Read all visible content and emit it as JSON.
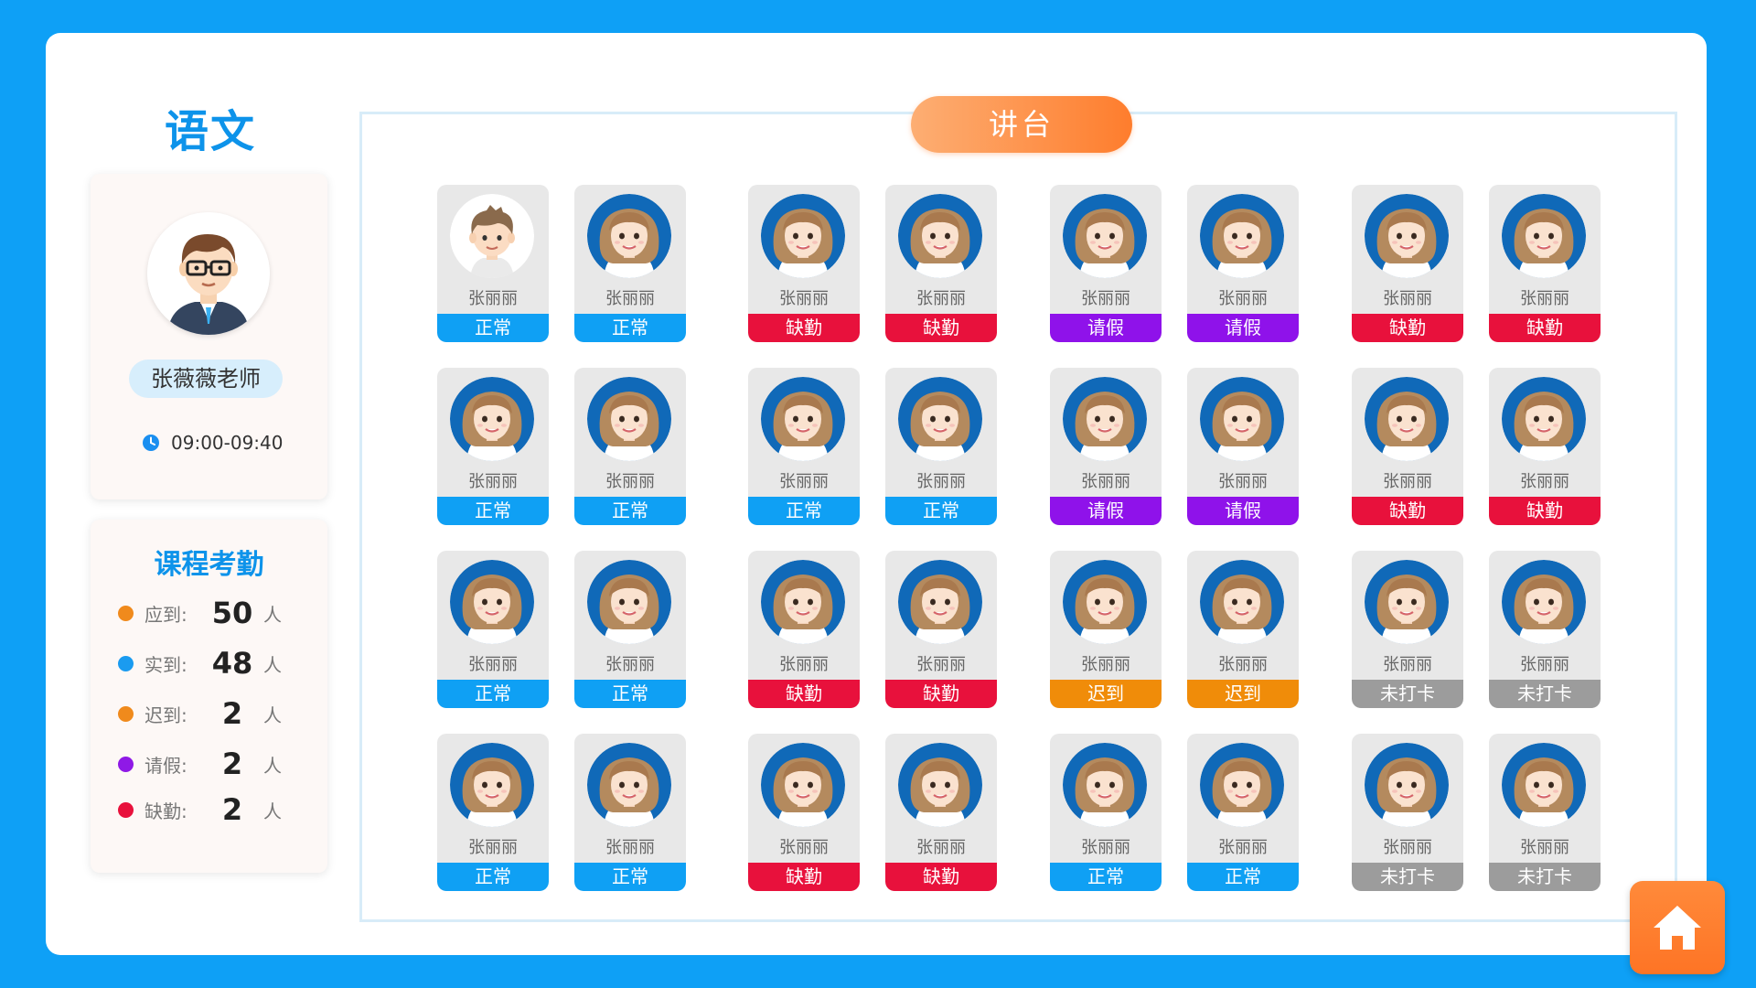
{
  "subject": {
    "title": "语文"
  },
  "teacher": {
    "name": "张薇薇老师",
    "time": "09:00-09:40"
  },
  "attendance": {
    "title": "课程考勤",
    "stats": [
      {
        "label": "应到:",
        "value": "50",
        "unit": "人",
        "color": "#f08a1c"
      },
      {
        "label": "实到:",
        "value": "48",
        "unit": "人",
        "color": "#1a9bf0"
      },
      {
        "label": "迟到:",
        "value": "2",
        "unit": "人",
        "color": "#f08a1c"
      },
      {
        "label": "请假:",
        "value": "2",
        "unit": "人",
        "color": "#8f19e6"
      },
      {
        "label": "缺勤:",
        "value": "2",
        "unit": "人",
        "color": "#e8113c"
      }
    ]
  },
  "classroom": {
    "podium_label": "讲台",
    "status_colors": {
      "正常": "#0fa0f4",
      "缺勤": "#e8113c",
      "请假": "#8f12ea",
      "迟到": "#f08c09",
      "未打卡": "#9c9c9c"
    },
    "rows": [
      [
        {
          "name": "张丽丽",
          "status": "正常",
          "avatar": "boy"
        },
        {
          "name": "张丽丽",
          "status": "正常",
          "avatar": "girl"
        },
        {
          "name": "张丽丽",
          "status": "缺勤",
          "avatar": "girl"
        },
        {
          "name": "张丽丽",
          "status": "缺勤",
          "avatar": "girl"
        },
        {
          "name": "张丽丽",
          "status": "请假",
          "avatar": "girl"
        },
        {
          "name": "张丽丽",
          "status": "请假",
          "avatar": "girl"
        },
        {
          "name": "张丽丽",
          "status": "缺勤",
          "avatar": "girl"
        },
        {
          "name": "张丽丽",
          "status": "缺勤",
          "avatar": "girl"
        }
      ],
      [
        {
          "name": "张丽丽",
          "status": "正常",
          "avatar": "girl"
        },
        {
          "name": "张丽丽",
          "status": "正常",
          "avatar": "girl"
        },
        {
          "name": "张丽丽",
          "status": "正常",
          "avatar": "girl"
        },
        {
          "name": "张丽丽",
          "status": "正常",
          "avatar": "girl"
        },
        {
          "name": "张丽丽",
          "status": "请假",
          "avatar": "girl"
        },
        {
          "name": "张丽丽",
          "status": "请假",
          "avatar": "girl"
        },
        {
          "name": "张丽丽",
          "status": "缺勤",
          "avatar": "girl"
        },
        {
          "name": "张丽丽",
          "status": "缺勤",
          "avatar": "girl"
        }
      ],
      [
        {
          "name": "张丽丽",
          "status": "正常",
          "avatar": "girl"
        },
        {
          "name": "张丽丽",
          "status": "正常",
          "avatar": "girl"
        },
        {
          "name": "张丽丽",
          "status": "缺勤",
          "avatar": "girl"
        },
        {
          "name": "张丽丽",
          "status": "缺勤",
          "avatar": "girl"
        },
        {
          "name": "张丽丽",
          "status": "迟到",
          "avatar": "girl"
        },
        {
          "name": "张丽丽",
          "status": "迟到",
          "avatar": "girl"
        },
        {
          "name": "张丽丽",
          "status": "未打卡",
          "avatar": "girl"
        },
        {
          "name": "张丽丽",
          "status": "未打卡",
          "avatar": "girl"
        }
      ],
      [
        {
          "name": "张丽丽",
          "status": "正常",
          "avatar": "girl"
        },
        {
          "name": "张丽丽",
          "status": "正常",
          "avatar": "girl"
        },
        {
          "name": "张丽丽",
          "status": "缺勤",
          "avatar": "girl"
        },
        {
          "name": "张丽丽",
          "status": "缺勤",
          "avatar": "girl"
        },
        {
          "name": "张丽丽",
          "status": "正常",
          "avatar": "girl"
        },
        {
          "name": "张丽丽",
          "status": "正常",
          "avatar": "girl"
        },
        {
          "name": "张丽丽",
          "status": "未打卡",
          "avatar": "girl"
        },
        {
          "name": "张丽丽",
          "status": "未打卡",
          "avatar": "girl"
        }
      ]
    ]
  },
  "home": {
    "icon": "home-icon"
  }
}
